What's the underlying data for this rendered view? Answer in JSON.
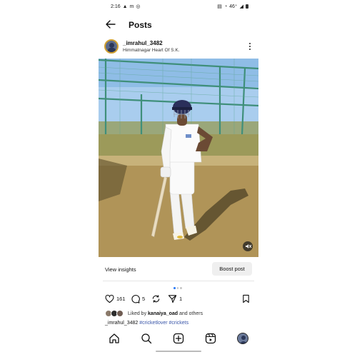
{
  "status_bar": {
    "time": "2:16",
    "network": "46⁺"
  },
  "header": {
    "title": "Posts"
  },
  "post": {
    "username": "_imrahul_3482",
    "location": "Himmatnagar Heart Of S.K.",
    "likes": "161",
    "comments": "5",
    "shares": "1",
    "liked_by_prefix": "Liked by ",
    "liked_by_user": "kanaiya_oad",
    "liked_by_suffix": " and others",
    "caption_user": "_imrahul_3482",
    "caption_tags": "#cricketlover #crickets"
  },
  "insights": {
    "view_label": "View insights",
    "boost_label": "Boost post"
  },
  "colors": {
    "accent": "#2f7df6",
    "tag": "#3854a8",
    "sky": "#9ec6ea",
    "ground": "#b49a5c"
  },
  "icons": [
    "back-arrow-icon",
    "more-options-icon",
    "mute-icon",
    "heart-icon",
    "comment-icon",
    "repost-icon",
    "share-icon",
    "bookmark-icon",
    "home-icon",
    "search-icon",
    "create-icon",
    "reels-icon",
    "profile-icon"
  ]
}
